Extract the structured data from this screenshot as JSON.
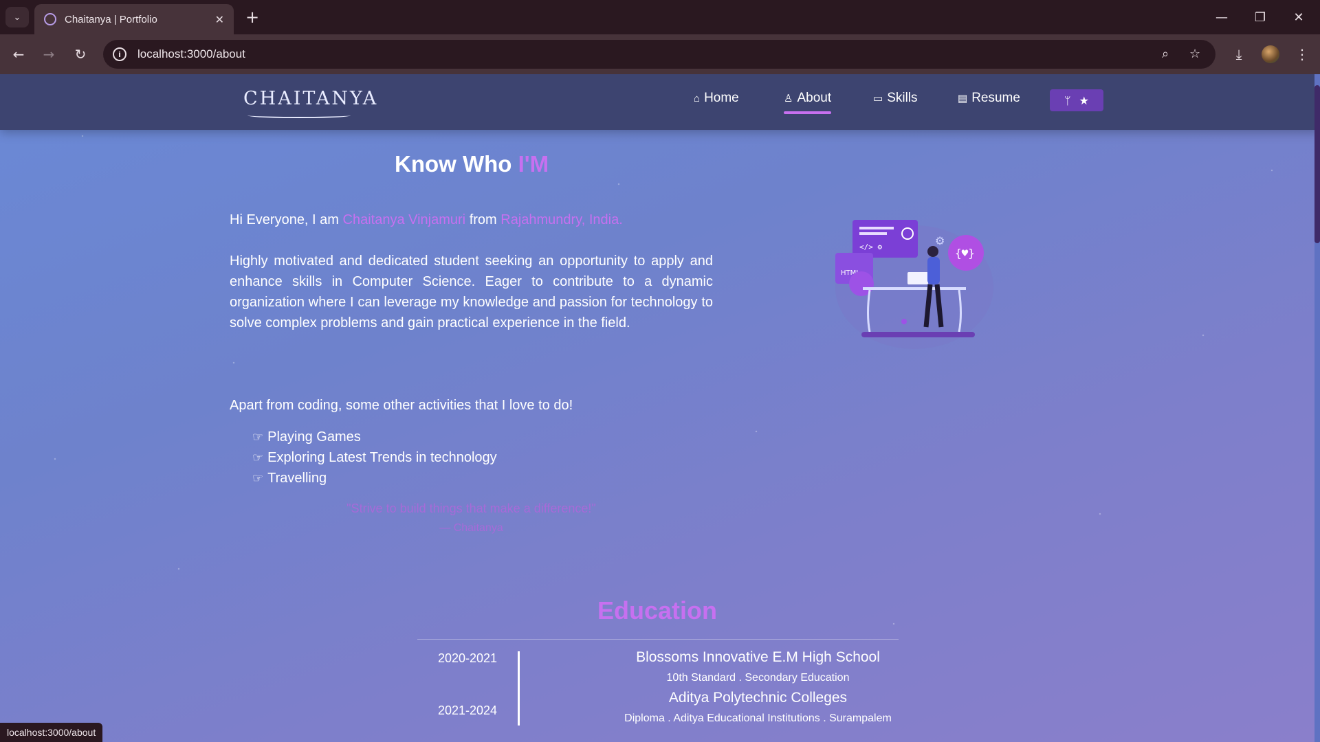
{
  "browser": {
    "tab_title": "Chaitanya | Portfolio",
    "url": "localhost:3000/about",
    "status_url": "localhost:3000/about"
  },
  "nav": {
    "logo": "CHAITANYA",
    "items": [
      {
        "label": "Home",
        "icon": "home-icon"
      },
      {
        "label": "About",
        "icon": "user-icon",
        "active": true
      },
      {
        "label": "Skills",
        "icon": "laptop-icon"
      },
      {
        "label": "Resume",
        "icon": "document-icon"
      }
    ],
    "fork_icons": [
      "fork-icon",
      "star-icon"
    ]
  },
  "about": {
    "heading_prefix": "Know Who ",
    "heading_accent": "I'M",
    "intro_a": "Hi Everyone, I am ",
    "intro_name": "Chaitanya Vinjamuri",
    "intro_b": " from ",
    "intro_place": "Rajahmundry, India.",
    "summary": "Highly motivated and dedicated student seeking an opportunity to apply and enhance skills in Computer Science. Eager to contribute to a dynamic organization where I can leverage my knowledge and passion for technology to solve complex problems and gain practical experience in the field.",
    "activities_intro": "Apart from coding, some other activities that I love to do!",
    "activities": [
      "Playing Games",
      "Exploring Latest Trends in technology",
      "Travelling"
    ],
    "quote": "\"Strive to build things that make a difference!\"",
    "quote_author": "— Chaitanya"
  },
  "education": {
    "title": "Education",
    "entries": [
      {
        "years": "2020-2021",
        "school": "Blossoms Innovative E.M High School",
        "detail": "10th Standard . Secondary Education"
      },
      {
        "years": "2021-2024",
        "school": "Aditya Polytechnic Colleges",
        "detail": "Diploma . Aditya Educational Institutions . Surampalem"
      }
    ]
  },
  "colors": {
    "accent": "#c770f0",
    "nav_bg": "#3d4470",
    "page_bg_start": "#6a89d6",
    "page_bg_end": "#8a7fcb"
  }
}
